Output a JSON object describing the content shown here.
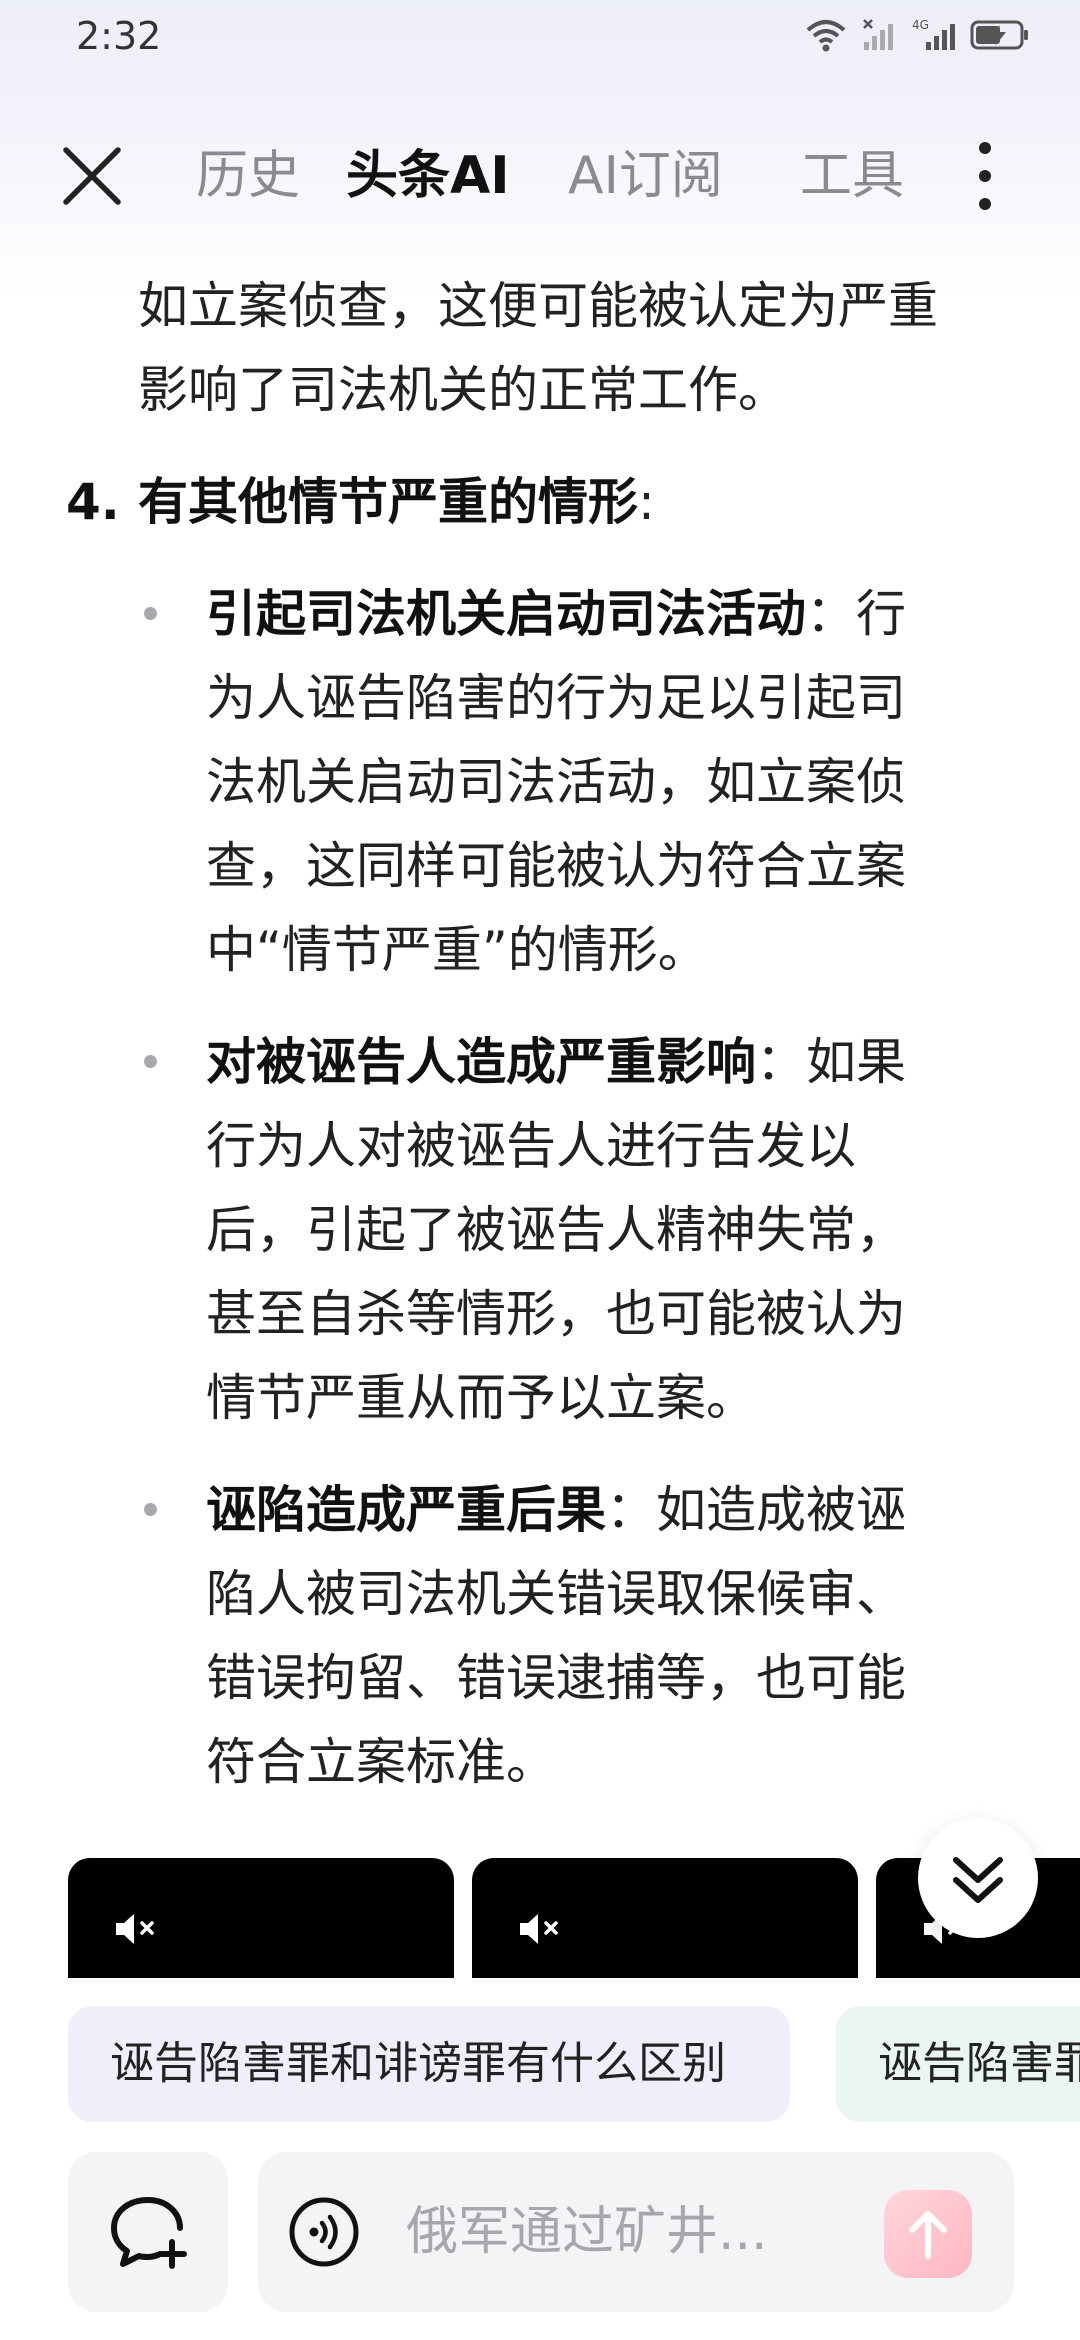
{
  "status_bar": {
    "time": "2:32",
    "network": "4G"
  },
  "nav": {
    "tabs": [
      {
        "label": "历史",
        "active": false
      },
      {
        "label": "头条AI",
        "active": true
      },
      {
        "label": "AI订阅",
        "active": false
      },
      {
        "label": "工具",
        "active": false
      }
    ]
  },
  "article": {
    "intro_line1": "如立案侦查，这便可能被认定为严重",
    "intro_line2": "影响了司法机关的正常工作。",
    "item4": {
      "number": "4.",
      "title": "有其他情节严重的情形",
      "colon": ":"
    },
    "bullets": [
      {
        "title": "引起司法机关启动司法活动",
        "lines": [
          "：行",
          "为人诬告陷害的行为足以引起司",
          "法机关启动司法活动，如立案侦",
          "查，这同样可能被认为符合立案",
          "中“情节严重”的情形。"
        ]
      },
      {
        "title": "对被诬告人造成严重影响",
        "lines": [
          "：如果",
          "行为人对被诬告人进行告发以",
          "后，引起了被诬告人精神失常，",
          "甚至自杀等情形，也可能被认为",
          "情节严重从而予以立案。"
        ]
      },
      {
        "title": "诬陷造成严重后果",
        "lines": [
          "：如造成被诬",
          "陷人被司法机关错误取保候审、",
          "错误拘留、错误逮捕等，也可能",
          "符合立案标准。"
        ]
      }
    ]
  },
  "suggestions": [
    {
      "label": "诬告陷害罪和诽谤罪有什么区别"
    },
    {
      "label": "诬告陷害罪"
    }
  ],
  "input": {
    "placeholder": "俄军通过矿井..."
  },
  "colors": {
    "chip1_bg": "#efeefa",
    "chip2_bg": "#eaf7f1",
    "send_button": "#ffb6c1"
  }
}
